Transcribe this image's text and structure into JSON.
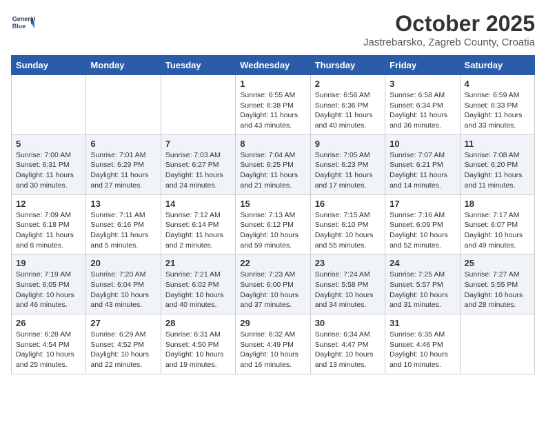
{
  "header": {
    "logo": {
      "general": "General",
      "blue": "Blue"
    },
    "title": "October 2025",
    "subtitle": "Jastrebarsko, Zagreb County, Croatia"
  },
  "calendar": {
    "weekdays": [
      "Sunday",
      "Monday",
      "Tuesday",
      "Wednesday",
      "Thursday",
      "Friday",
      "Saturday"
    ],
    "weeks": [
      [
        {
          "day": "",
          "info": ""
        },
        {
          "day": "",
          "info": ""
        },
        {
          "day": "",
          "info": ""
        },
        {
          "day": "1",
          "info": "Sunrise: 6:55 AM\nSunset: 6:38 PM\nDaylight: 11 hours and 43 minutes."
        },
        {
          "day": "2",
          "info": "Sunrise: 6:56 AM\nSunset: 6:36 PM\nDaylight: 11 hours and 40 minutes."
        },
        {
          "day": "3",
          "info": "Sunrise: 6:58 AM\nSunset: 6:34 PM\nDaylight: 11 hours and 36 minutes."
        },
        {
          "day": "4",
          "info": "Sunrise: 6:59 AM\nSunset: 6:33 PM\nDaylight: 11 hours and 33 minutes."
        }
      ],
      [
        {
          "day": "5",
          "info": "Sunrise: 7:00 AM\nSunset: 6:31 PM\nDaylight: 11 hours and 30 minutes."
        },
        {
          "day": "6",
          "info": "Sunrise: 7:01 AM\nSunset: 6:29 PM\nDaylight: 11 hours and 27 minutes."
        },
        {
          "day": "7",
          "info": "Sunrise: 7:03 AM\nSunset: 6:27 PM\nDaylight: 11 hours and 24 minutes."
        },
        {
          "day": "8",
          "info": "Sunrise: 7:04 AM\nSunset: 6:25 PM\nDaylight: 11 hours and 21 minutes."
        },
        {
          "day": "9",
          "info": "Sunrise: 7:05 AM\nSunset: 6:23 PM\nDaylight: 11 hours and 17 minutes."
        },
        {
          "day": "10",
          "info": "Sunrise: 7:07 AM\nSunset: 6:21 PM\nDaylight: 11 hours and 14 minutes."
        },
        {
          "day": "11",
          "info": "Sunrise: 7:08 AM\nSunset: 6:20 PM\nDaylight: 11 hours and 11 minutes."
        }
      ],
      [
        {
          "day": "12",
          "info": "Sunrise: 7:09 AM\nSunset: 6:18 PM\nDaylight: 11 hours and 8 minutes."
        },
        {
          "day": "13",
          "info": "Sunrise: 7:11 AM\nSunset: 6:16 PM\nDaylight: 11 hours and 5 minutes."
        },
        {
          "day": "14",
          "info": "Sunrise: 7:12 AM\nSunset: 6:14 PM\nDaylight: 11 hours and 2 minutes."
        },
        {
          "day": "15",
          "info": "Sunrise: 7:13 AM\nSunset: 6:12 PM\nDaylight: 10 hours and 59 minutes."
        },
        {
          "day": "16",
          "info": "Sunrise: 7:15 AM\nSunset: 6:10 PM\nDaylight: 10 hours and 55 minutes."
        },
        {
          "day": "17",
          "info": "Sunrise: 7:16 AM\nSunset: 6:09 PM\nDaylight: 10 hours and 52 minutes."
        },
        {
          "day": "18",
          "info": "Sunrise: 7:17 AM\nSunset: 6:07 PM\nDaylight: 10 hours and 49 minutes."
        }
      ],
      [
        {
          "day": "19",
          "info": "Sunrise: 7:19 AM\nSunset: 6:05 PM\nDaylight: 10 hours and 46 minutes."
        },
        {
          "day": "20",
          "info": "Sunrise: 7:20 AM\nSunset: 6:04 PM\nDaylight: 10 hours and 43 minutes."
        },
        {
          "day": "21",
          "info": "Sunrise: 7:21 AM\nSunset: 6:02 PM\nDaylight: 10 hours and 40 minutes."
        },
        {
          "day": "22",
          "info": "Sunrise: 7:23 AM\nSunset: 6:00 PM\nDaylight: 10 hours and 37 minutes."
        },
        {
          "day": "23",
          "info": "Sunrise: 7:24 AM\nSunset: 5:58 PM\nDaylight: 10 hours and 34 minutes."
        },
        {
          "day": "24",
          "info": "Sunrise: 7:25 AM\nSunset: 5:57 PM\nDaylight: 10 hours and 31 minutes."
        },
        {
          "day": "25",
          "info": "Sunrise: 7:27 AM\nSunset: 5:55 PM\nDaylight: 10 hours and 28 minutes."
        }
      ],
      [
        {
          "day": "26",
          "info": "Sunrise: 6:28 AM\nSunset: 4:54 PM\nDaylight: 10 hours and 25 minutes."
        },
        {
          "day": "27",
          "info": "Sunrise: 6:29 AM\nSunset: 4:52 PM\nDaylight: 10 hours and 22 minutes."
        },
        {
          "day": "28",
          "info": "Sunrise: 6:31 AM\nSunset: 4:50 PM\nDaylight: 10 hours and 19 minutes."
        },
        {
          "day": "29",
          "info": "Sunrise: 6:32 AM\nSunset: 4:49 PM\nDaylight: 10 hours and 16 minutes."
        },
        {
          "day": "30",
          "info": "Sunrise: 6:34 AM\nSunset: 4:47 PM\nDaylight: 10 hours and 13 minutes."
        },
        {
          "day": "31",
          "info": "Sunrise: 6:35 AM\nSunset: 4:46 PM\nDaylight: 10 hours and 10 minutes."
        },
        {
          "day": "",
          "info": ""
        }
      ]
    ]
  }
}
